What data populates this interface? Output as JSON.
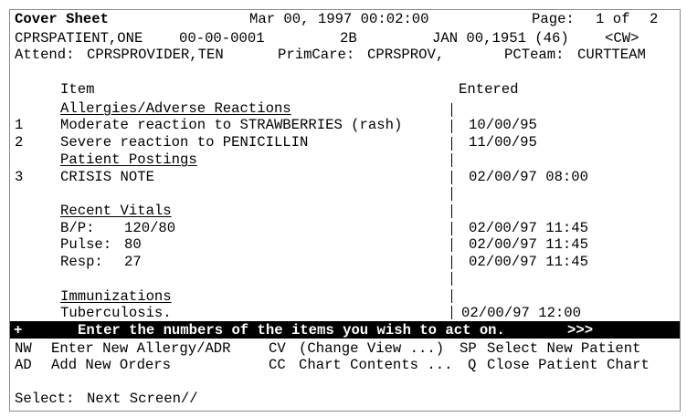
{
  "header": {
    "title": "Cover Sheet",
    "date": "Mar 00, 1997 00:02:00",
    "page_label": "Page:",
    "page_num": "1 of",
    "page_total": "2",
    "patient": "CPRSPATIENT,ONE",
    "ssn": "00-00-0001",
    "ward": "2B",
    "dob": "JAN 00,1951 (46)",
    "cw": "<CW>",
    "attend_label": "Attend:",
    "attend": "CPRSPROVIDER,TEN",
    "primcare_label": "PrimCare:",
    "primcare": "CPRSPROV,",
    "pcteam_label": "PCTeam:",
    "pcteam": "CURTTEAM"
  },
  "columns": {
    "item": "Item",
    "entered": "Entered"
  },
  "sections": {
    "allergies": {
      "heading": "Allergies/Adverse Reactions",
      "items": [
        {
          "num": "1",
          "text": "Moderate reaction to STRAWBERRIES (rash)",
          "entered": "10/00/95"
        },
        {
          "num": "2",
          "text": "Severe reaction to PENICILLIN",
          "entered": "11/00/95"
        }
      ]
    },
    "postings": {
      "heading": "Patient Postings",
      "items": [
        {
          "num": "3",
          "text": "CRISIS NOTE",
          "entered": "02/00/97 08:00"
        }
      ]
    },
    "vitals": {
      "heading": "Recent Vitals",
      "items": [
        {
          "label": "B/P:",
          "value": "120/80",
          "entered": "02/00/97 11:45"
        },
        {
          "label": "Pulse:",
          "value": "80",
          "entered": "02/00/97 11:45"
        },
        {
          "label": "Resp:",
          "value": "27",
          "entered": "02/00/97 11:45"
        }
      ]
    },
    "immunizations": {
      "heading": "Immunizations",
      "items": [
        {
          "text": "Tuberculosis.",
          "entered": "02/00/97 12:00"
        }
      ]
    }
  },
  "prompt_bar": {
    "plus": "+",
    "text": "Enter the numbers of the items you wish to act on.",
    "arrows": ">>>"
  },
  "actions": {
    "nw_code": "NW",
    "nw_label": "Enter New Allergy/ADR",
    "cv_code": "CV",
    "cv_label": "(Change View ...)",
    "sp_code": "SP",
    "sp_label": "Select New Patient",
    "ad_code": "AD",
    "ad_label": "Add New Orders",
    "cc_code": "CC",
    "cc_label": "Chart Contents ...",
    "q_code": "Q",
    "q_label": "Close Patient Chart"
  },
  "select": {
    "label": "Select:",
    "default": "Next Screen//"
  }
}
